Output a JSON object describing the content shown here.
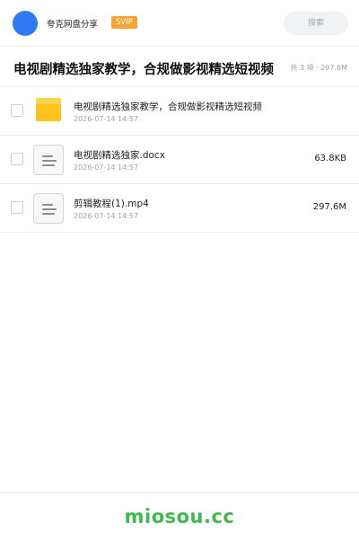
{
  "header": {
    "share_name": "夸克网盘分享",
    "badge": "SVIP",
    "search_label": "搜索",
    "avatar_color": "#2f7bf5"
  },
  "share": {
    "title": "电视剧精选独家教学，合规做影视精选短视频",
    "summary": "共 3 项 · 297.6M"
  },
  "files": [
    {
      "name": "电视剧精选独家教学，合规做影视精选短视频",
      "date": "2026-07-14 14:57",
      "size": "",
      "icon": "folder-icon"
    },
    {
      "name": "电视剧精选独家.docx",
      "date": "2026-07-14 14:57",
      "size": "63.8KB",
      "icon": "document-icon"
    },
    {
      "name": "剪辑教程(1).mp4",
      "date": "2026-07-14 14:57",
      "size": "297.6M",
      "icon": "document-icon"
    }
  ],
  "footer": {
    "brand": "miosou.cc",
    "brand_color": "#3dba4e"
  }
}
